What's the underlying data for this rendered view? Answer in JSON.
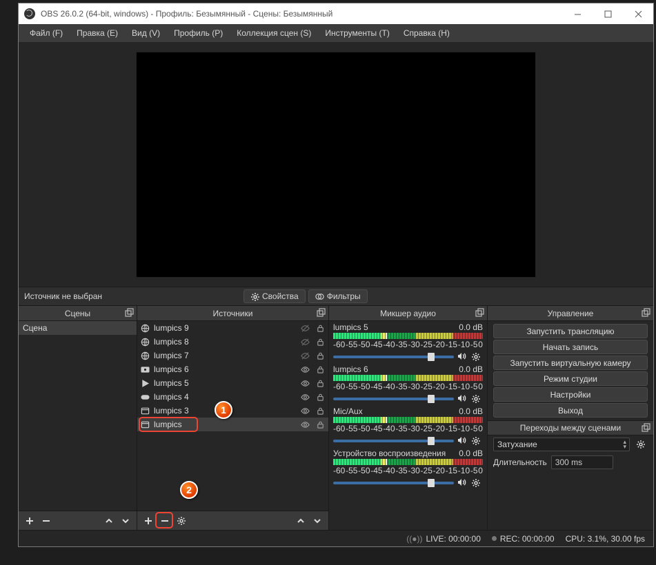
{
  "titlebar": {
    "title": "OBS 26.0.2 (64-bit, windows) - Профиль: Безымянный - Сцены: Безымянный"
  },
  "menu": [
    "Файл (F)",
    "Правка (E)",
    "Вид (V)",
    "Профиль (P)",
    "Коллекция сцен (S)",
    "Инструменты (T)",
    "Справка (H)"
  ],
  "midbar": {
    "noSource": "Источник не выбран",
    "properties": "Свойства",
    "filters": "Фильтры"
  },
  "docks": {
    "scenes": "Сцены",
    "sources": "Источники",
    "mixer": "Микшер аудио",
    "controls": "Управление",
    "transitions": "Переходы между сценами"
  },
  "scenes": [
    "Сцена"
  ],
  "sources": [
    {
      "name": "lumpics 9",
      "icon": "globe",
      "visible": false
    },
    {
      "name": "lumpics 8",
      "icon": "globe",
      "visible": false
    },
    {
      "name": "lumpics 7",
      "icon": "globe",
      "visible": false
    },
    {
      "name": "lumpics 6",
      "icon": "camera",
      "visible": true
    },
    {
      "name": "lumpics 5",
      "icon": "play",
      "visible": true
    },
    {
      "name": "lumpics 4",
      "icon": "gamepad",
      "visible": true
    },
    {
      "name": "lumpics 3",
      "icon": "window",
      "visible": true
    },
    {
      "name": "lumpics",
      "icon": "window",
      "visible": true,
      "selected": true
    }
  ],
  "mixer": {
    "channels": [
      {
        "name": "lumpics 5",
        "level": "0.0 dB"
      },
      {
        "name": "lumpics 6",
        "level": "0.0 dB"
      },
      {
        "name": "Mic/Aux",
        "level": "0.0 dB"
      },
      {
        "name": "Устройство воспроизведения",
        "level": "0.0 dB"
      }
    ],
    "scale": [
      "-60",
      "-55",
      "-50",
      "-45",
      "-40",
      "-35",
      "-30",
      "-25",
      "-20",
      "-15",
      "-10",
      "-5",
      "0"
    ]
  },
  "controls": {
    "buttons": [
      "Запустить трансляцию",
      "Начать запись",
      "Запустить виртуальную камеру",
      "Режим студии",
      "Настройки",
      "Выход"
    ]
  },
  "transitions": {
    "type": "Затухание",
    "durationLabel": "Длительность",
    "duration": "300 ms"
  },
  "status": {
    "live": "LIVE: 00:00:00",
    "rec": "REC: 00:00:00",
    "cpu": "CPU: 3.1%, 30.00 fps"
  },
  "annotations": {
    "a1": "1",
    "a2": "2"
  }
}
